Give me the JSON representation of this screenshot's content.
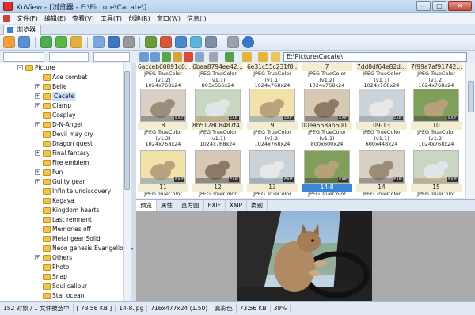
{
  "window": {
    "title": "XnView - [浏览器 - E:\\Picture\\Cacate\\]"
  },
  "menu": [
    "文件(F)",
    "编辑(E)",
    "查看(V)",
    "工具(T)",
    "创建(R)",
    "窗口(W)",
    "信息(I)"
  ],
  "tab": {
    "label": "浏览器"
  },
  "address": {
    "path": "E:\\Picture\\Cacate\\"
  },
  "tree": {
    "root": "Picture",
    "items": [
      {
        "label": "Ace combat",
        "exp": false
      },
      {
        "label": "Belle",
        "exp": true
      },
      {
        "label": "Cacate",
        "exp": true,
        "selected": true
      },
      {
        "label": "Clamp",
        "exp": true
      },
      {
        "label": "Cosplay",
        "exp": false
      },
      {
        "label": "D-N-Angel",
        "exp": true
      },
      {
        "label": "Devil may cry",
        "exp": false
      },
      {
        "label": "Dragon quest",
        "exp": false
      },
      {
        "label": "Final fantasy",
        "exp": true
      },
      {
        "label": "Fire emblem",
        "exp": false
      },
      {
        "label": "Fun",
        "exp": true
      },
      {
        "label": "Guilty gear",
        "exp": true
      },
      {
        "label": "Infinite undiscovery",
        "exp": false
      },
      {
        "label": "Kagaya",
        "exp": false
      },
      {
        "label": "Kingdom hearts",
        "exp": false
      },
      {
        "label": "Last remnant",
        "exp": false
      },
      {
        "label": "Memories off",
        "exp": false
      },
      {
        "label": "Metal gear Solid",
        "exp": false
      },
      {
        "label": "Neon genesis Evangelion",
        "exp": false
      },
      {
        "label": "Others",
        "exp": true
      },
      {
        "label": "Photo",
        "exp": false
      },
      {
        "label": "Snap",
        "exp": false
      },
      {
        "label": "Soul calibur",
        "exp": false
      },
      {
        "label": "Star ocean",
        "exp": false
      }
    ]
  },
  "grid": {
    "partial_row": [
      {
        "name": "6acceb60891c0...",
        "fmt": "JPEG TrueColor (v1.2)",
        "size": "1024x768x24"
      },
      {
        "name": "6baa8794ee42...",
        "fmt": "JPEG TrueColor (v1.1)",
        "size": "803x666x24"
      },
      {
        "name": "6e31c55c231f8...",
        "fmt": "JPEG TrueColor (v1.1)",
        "size": "1024x768x24"
      },
      {
        "name": "7",
        "fmt": "JPEG TrueColor (v1.2)",
        "size": "1024x768x24"
      },
      {
        "name": "7dd8df64e82d...",
        "fmt": "JPEG TrueColor (v1.1)",
        "size": "1024x768x24"
      },
      {
        "name": "7f99a7af91742...",
        "fmt": "JPEG TrueColor (v1.2)",
        "size": "1024x768x24"
      }
    ],
    "row2": [
      {
        "name": "8",
        "fmt": "JPEG TrueColor (v1.2)",
        "size": "1024x768x24"
      },
      {
        "name": "8b512808487f4...",
        "fmt": "JPEG TrueColor (v1.1)",
        "size": "1024x768x24"
      },
      {
        "name": "9",
        "fmt": "JPEG TrueColor (v1.2)",
        "size": "1024x768x24"
      },
      {
        "name": "00ea558ab600...",
        "fmt": "JPEG TrueColor (v1.1)",
        "size": "800x600x24"
      },
      {
        "name": "09-13",
        "fmt": "JPEG TrueColor (v1.1)",
        "size": "600x448x24"
      },
      {
        "name": "10",
        "fmt": "JPEG TrueColor (v1.2)",
        "size": "1024x768x24"
      }
    ],
    "row3": [
      {
        "name": "11",
        "fmt": "JPEG TrueColor (v1.2)",
        "size": ""
      },
      {
        "name": "12",
        "fmt": "JPEG TrueColor (v1.2)",
        "size": ""
      },
      {
        "name": "13",
        "fmt": "JPEG TrueColor (v1.2)",
        "size": ""
      },
      {
        "name": "14-8",
        "fmt": "JPEG TrueColor (v1.1)",
        "size": "",
        "selected": true
      },
      {
        "name": "14",
        "fmt": "JPEG TrueColor (v1.2)",
        "size": ""
      },
      {
        "name": "15",
        "fmt": "JPEG TrueColor (v1.2)",
        "size": ""
      }
    ],
    "exif_label": "EXIF"
  },
  "preview_tabs": [
    "预览",
    "属性",
    "直方图",
    "EXIF",
    "XMP",
    "类别"
  ],
  "status": {
    "count": "152 对象 / 1 文件被选中",
    "selsize": "[ 73.56 KB ]",
    "file": "14-8.jpg",
    "dims": "716x477x24 (1.50)",
    "color": "真彩色",
    "size": "73.56 KB",
    "zoom": "39%"
  }
}
